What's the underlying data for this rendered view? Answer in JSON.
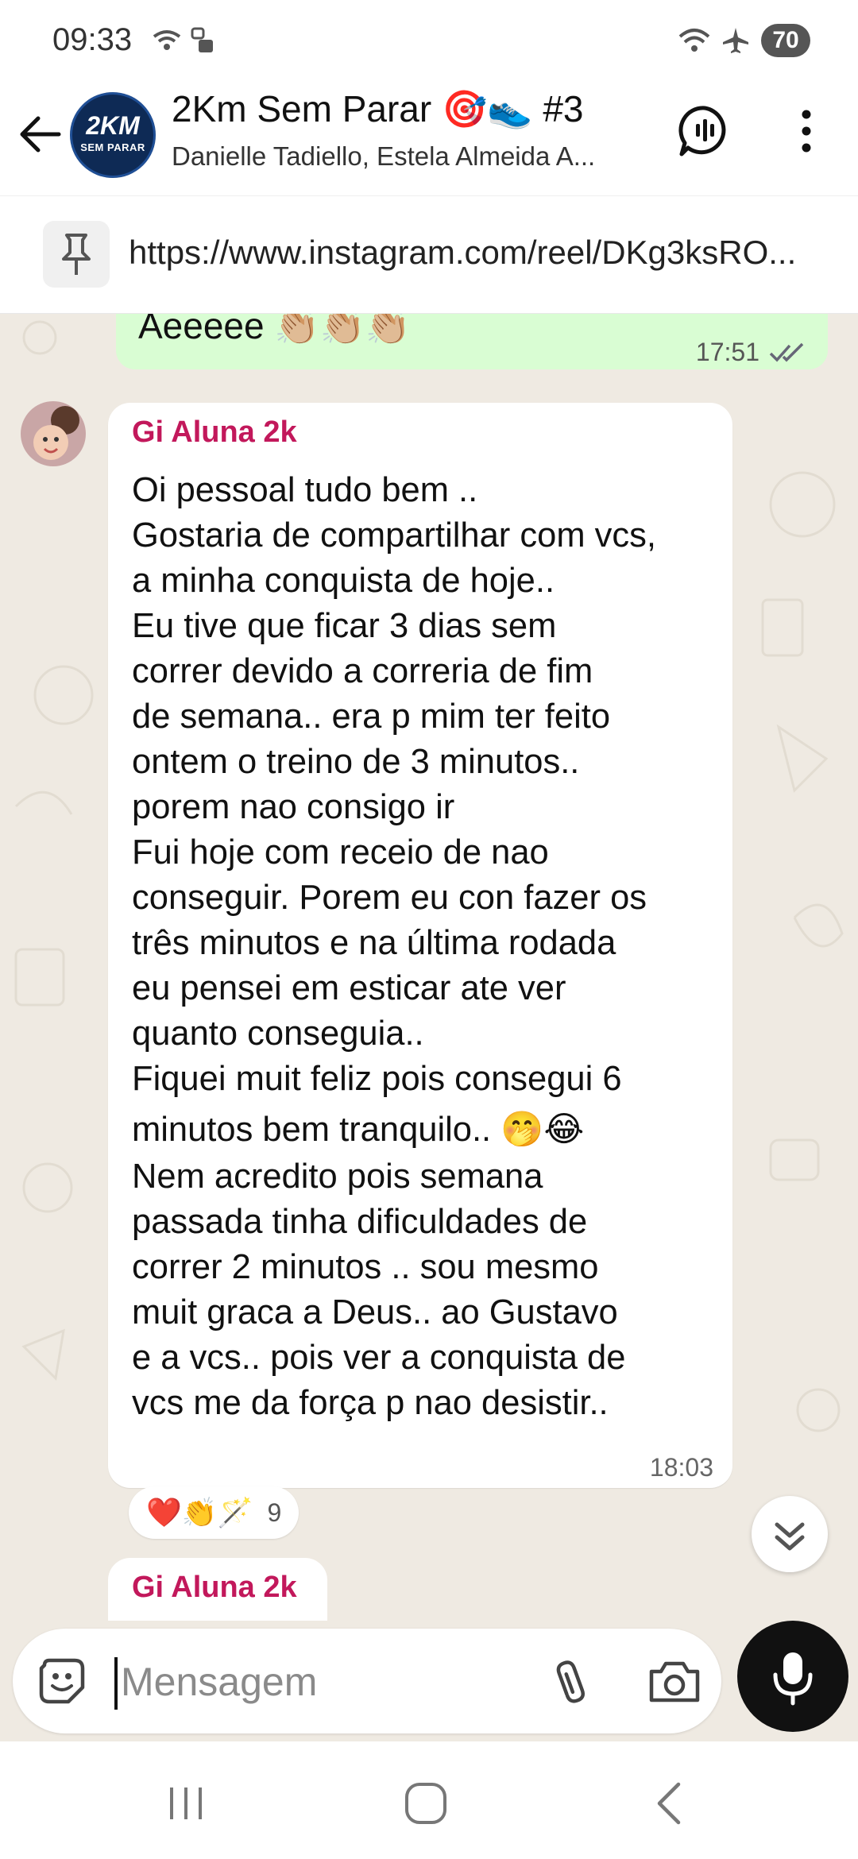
{
  "status": {
    "time": "09:33",
    "battery": "70"
  },
  "header": {
    "title": "2Km Sem Parar 🎯👟 #3",
    "subtitle": "Danielle Tadiello, Estela Almeida A...",
    "avatar_text_main": "2KM",
    "avatar_text_sub": "SEM PARAR"
  },
  "pinned": {
    "text": "https://www.instagram.com/reel/DKg3ksRO..."
  },
  "messages": {
    "outgoing": {
      "text": "Aeeeee 👏🏼👏🏼👏🏼",
      "time": "17:51"
    },
    "incoming": {
      "sender": "Gi Aluna 2k",
      "lines": [
        "Oi pessoal tudo bem ..",
        "Gostaria de compartilhar com vcs,",
        "a minha conquista de hoje..",
        "Eu tive que ficar 3 dias sem",
        "correr devido a correria  de fim",
        "de semana.. era p mim ter feito",
        "ontem o treino de 3 minutos..",
        "porem nao consigo  ir",
        "Fui hoje com receio  de nao",
        "conseguir.  Porem eu con fazer os",
        "três  minutos  e na última rodada",
        "eu pensei  em esticar ate ver",
        "quanto  conseguia..",
        "Fiquei muit feliz pois consegui  6",
        "minutos bem tranquilo.. 🤭😂",
        "Nem acredito pois semana",
        "passada tinha dificuldades  de",
        "correr 2 minutos .. sou mesmo",
        "muit graca a Deus..  ao Gustavo",
        "e a vcs.. pois ver a conquista  de",
        "vcs me da força  p nao desistir.."
      ],
      "time": "18:03",
      "reactions": "❤️👏🪄",
      "reaction_count": "9"
    },
    "next_sender": "Gi Aluna 2k"
  },
  "input": {
    "placeholder": "Mensagem"
  },
  "colors": {
    "outgoing_bubble": "#d9fdd3",
    "chat_background": "#efeae2",
    "sender_name": "#c2185b",
    "mic_button": "#111111"
  }
}
